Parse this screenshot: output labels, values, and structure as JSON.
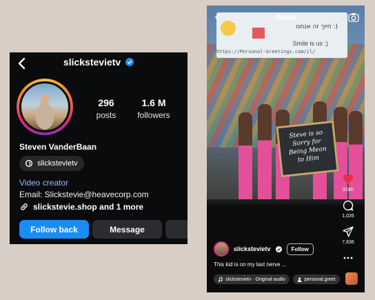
{
  "profile": {
    "username": "slickstevietv",
    "full_name": "Steven VanderBaan",
    "stats": [
      {
        "value": "296",
        "label": "posts"
      },
      {
        "value": "1.6 M",
        "label": "followers"
      }
    ],
    "threads_handle": "slickstevietv",
    "category": "Video creator",
    "email_line": "Email: Slickstevie@heavecorp.com",
    "link_text": "slickstevie.shop and 1 more",
    "buttons": {
      "follow_back": "Follow back",
      "message": "Message"
    },
    "colors": {
      "accent": "#1a8cf5",
      "verified": "#1a8cf5",
      "category": "#9ab9f5"
    }
  },
  "reels": {
    "title": "Reels",
    "banner": {
      "hebrew": "חיוך זה אנחנו :)",
      "english": "Smile is us :)",
      "url": "https://Personal-Greetings.com/il/"
    },
    "sign_text": "Steve is so Sorry for Being Mean to Him",
    "actions": {
      "likes": "318K",
      "comments": "1,026",
      "shares": "7,836"
    },
    "creator": "slickstevietv",
    "follow_label": "Follow",
    "caption": "This kid is on my last nerve ...",
    "audio_label": "slickstevietv · Original audio",
    "tag_label": "personal.greet"
  }
}
